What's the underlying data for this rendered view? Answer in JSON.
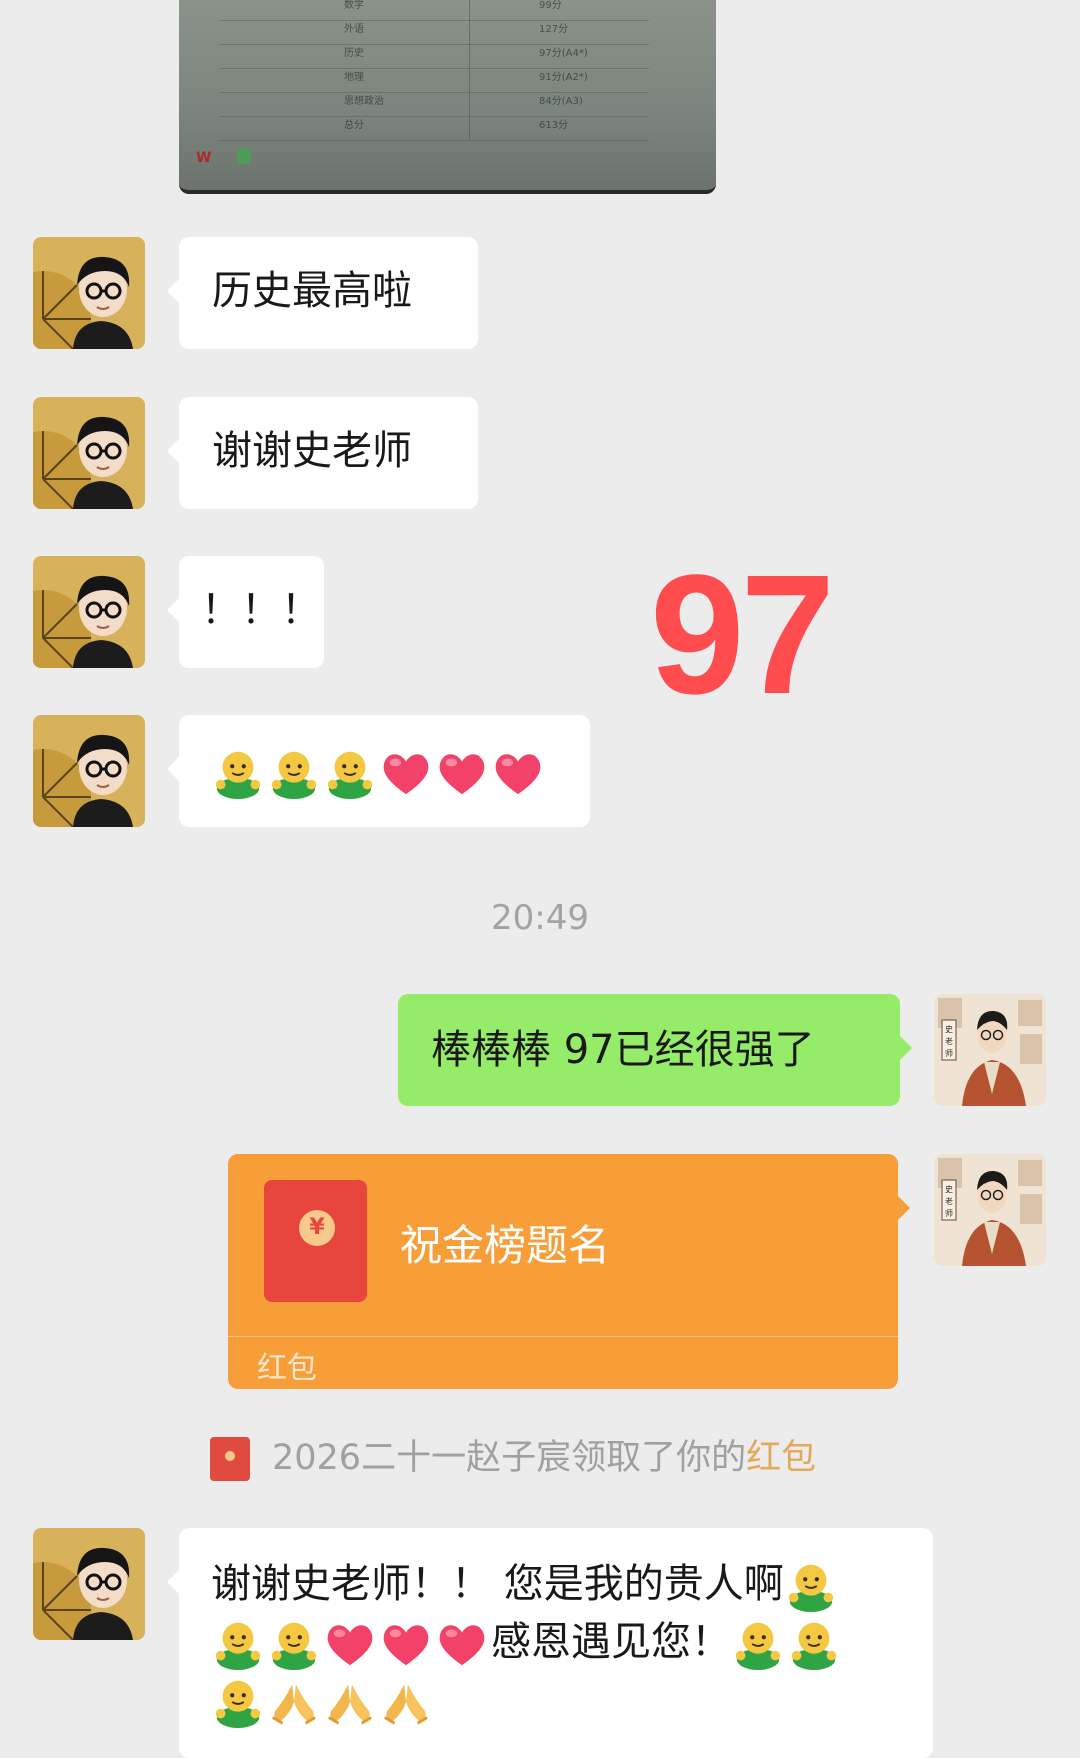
{
  "photo": {
    "rows": [
      {
        "subject": "数学",
        "score": "99分"
      },
      {
        "subject": "外语",
        "score": "127分"
      },
      {
        "subject": "历史",
        "score": "97分(A4*)"
      },
      {
        "subject": "地理",
        "score": "91分(A2*)"
      },
      {
        "subject": "思想政治",
        "score": "84分(A3)"
      },
      {
        "subject": "总分",
        "score": "613分"
      }
    ],
    "app_logo": "W"
  },
  "messages": [
    {
      "side": "left",
      "text": "历史最高啦"
    },
    {
      "side": "left",
      "text": "谢谢史老师"
    },
    {
      "side": "left",
      "text": "！！！"
    },
    {
      "side": "left",
      "emojis": [
        "hug-emoji",
        "hug-emoji",
        "hug-emoji",
        "heart-emoji",
        "heart-emoji",
        "heart-emoji"
      ]
    }
  ],
  "annotation": "97",
  "timestamp": "20:49",
  "sent_message": "棒棒棒 97已经很强了",
  "red_packet": {
    "title": "祝金榜题名",
    "tag": "红包",
    "coin_symbol": "¥"
  },
  "notice": {
    "text": "2026二十一赵子宸领取了你的",
    "link": "红包"
  },
  "last_message": {
    "part1": "谢谢史老师！！ 您是我的贵人啊",
    "part2": "感恩遇见您！"
  },
  "colors": {
    "background": "#ececec",
    "sent_bubble": "#95ec69",
    "red_packet": "#f79e39",
    "annotation": "#ff4d4f"
  }
}
